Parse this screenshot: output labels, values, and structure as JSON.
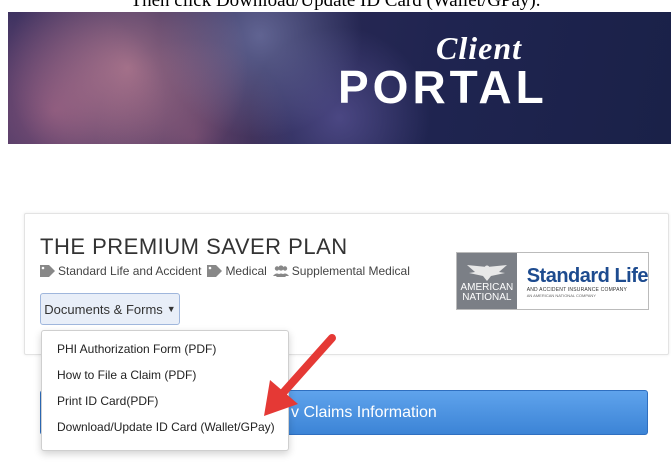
{
  "instruction_text": "Then click Download/Update ID Card (Wallet/GPay).",
  "banner": {
    "logo_top": "Client",
    "logo_bottom": "PORTAL"
  },
  "plan": {
    "title": "THE PREMIUM SAVER PLAN",
    "tags": [
      {
        "icon": "tag-icon",
        "label": "Standard Life and Accident"
      },
      {
        "icon": "tag-icon",
        "label": "Medical"
      },
      {
        "icon": "users-icon",
        "label": "Supplemental Medical"
      }
    ]
  },
  "documents_button": {
    "label": "Documents & Forms"
  },
  "dropdown": {
    "items": [
      "PHI Authorization Form (PDF)",
      "How to File a Claim (PDF)",
      "Print ID Card(PDF)",
      "Download/Update ID Card (Wallet/GPay)"
    ]
  },
  "insurer_logo": {
    "left_top": "AMERICAN",
    "left_bottom": "NATIONAL",
    "name": "Standard Life",
    "subtitle": "AND ACCIDENT INSURANCE COMPANY",
    "subtitle2": "AN AMERICAN NATIONAL COMPANY"
  },
  "claims_button": {
    "label": "v Claims Information"
  },
  "colors": {
    "banner": "#2d2a55",
    "accent_blue": "#3c84d6",
    "arrow_red": "#e53935",
    "brand_blue": "#1d4b8f"
  }
}
